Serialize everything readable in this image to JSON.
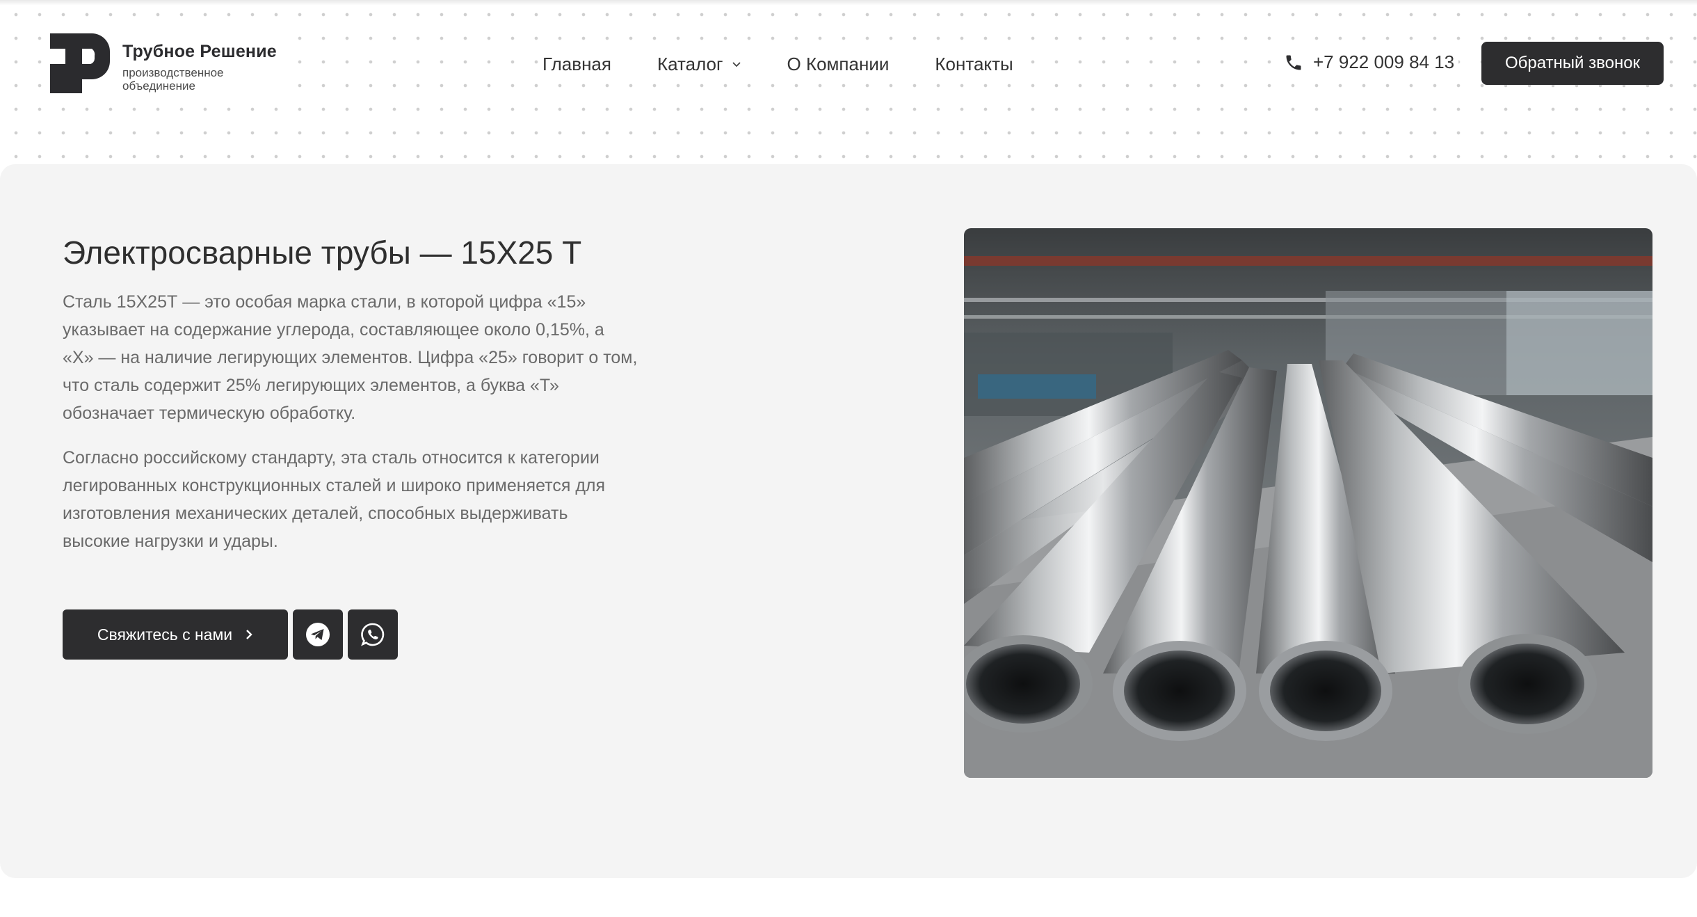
{
  "brand": {
    "name": "Трубное Решение",
    "subtitle": "производственное объединение"
  },
  "nav": {
    "items": [
      {
        "label": "Главная"
      },
      {
        "label": "Каталог",
        "has_dropdown": true
      },
      {
        "label": "О Компании"
      },
      {
        "label": "Контакты"
      }
    ]
  },
  "header": {
    "phone": "+7 922 009 84 13",
    "callback_label": "Обратный звонок",
    "icons": {
      "phone": "phone-icon",
      "dropdown": "chevron-down-icon"
    }
  },
  "hero": {
    "title": "Электросварные трубы — 15Х25 Т",
    "paragraph1": "Сталь 15Х25Т — это особая марка стали, в которой цифра «15» указывает на содержание углерода, составляющее около 0,15%, а «Х» — на наличие легирующих элементов. Цифра «25» говорит о том, что сталь содержит 25% легирующих элементов, а буква «Т» обозначает термическую обработку.",
    "paragraph2": "Согласно российскому стандарту, эта сталь относится к категории легированных конструкционных сталей и широко применяется для изготовления механических деталей, способных выдерживать высокие нагрузки и удары.",
    "contact_label": "Свяжитесь с нами",
    "icons": {
      "arrow": "chevron-right-icon",
      "telegram": "telegram-icon",
      "whatsapp": "whatsapp-icon"
    },
    "image": {
      "subject": "stainless-steel-pipes-photo"
    }
  },
  "colors": {
    "dark": "#2d2d2f",
    "hero_bg": "#f4f4f4",
    "text_muted": "#6a6a6a"
  }
}
